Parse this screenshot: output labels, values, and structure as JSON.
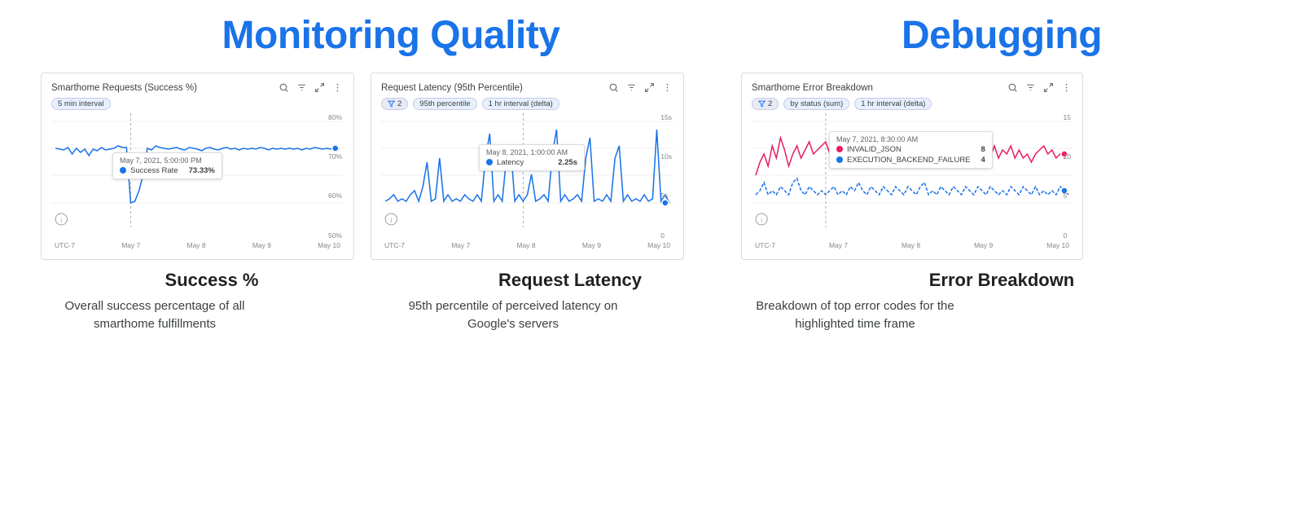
{
  "monitoring": {
    "title": "Monitoring Quality",
    "charts": [
      {
        "id": "success-rate",
        "title": "Smarthome Requests (Success %)",
        "chip": "5 min interval",
        "chip_filter": null,
        "tooltip_date": "May 7, 2021, 5:00:00 PM",
        "tooltip_label": "Success Rate",
        "tooltip_value": "73.33%",
        "tooltip_color": "#1a73e8",
        "y_labels": [
          "80%",
          "70%",
          "60%",
          "50%"
        ],
        "x_labels": [
          "UTC-7",
          "May 7",
          "May 8",
          "May 9",
          "May 10"
        ]
      },
      {
        "id": "request-latency",
        "title": "Request Latency (95th Percentile)",
        "chip": "95th percentile",
        "chip2": "1 hr interval (delta)",
        "chip_filter": "2",
        "tooltip_date": "May 8, 2021, 1:00:00 AM",
        "tooltip_label": "Latency",
        "tooltip_value": "2.25s",
        "tooltip_color": "#1a73e8",
        "y_labels": [
          "15s",
          "10s",
          "5s",
          "0"
        ],
        "x_labels": [
          "UTC-7",
          "May 7",
          "May 8",
          "May 9",
          "May 10"
        ]
      }
    ],
    "labels": [
      {
        "title": "Success %",
        "desc": "Overall success percentage of all smarthome fulfillments"
      },
      {
        "title": "Request Latency",
        "desc": "95th percentile of perceived latency on Google's servers"
      }
    ]
  },
  "debugging": {
    "title": "Debugging",
    "chart": {
      "id": "error-breakdown",
      "title": "Smarthome Error Breakdown",
      "chip_filter": "2",
      "chip2": "by status (sum)",
      "chip3": "1 hr interval (delta)",
      "tooltip_date": "May 7, 2021, 8:30:00 AM",
      "tooltip_rows": [
        {
          "label": "INVALID_JSON",
          "value": "8",
          "color": "#e91e63"
        },
        {
          "label": "EXECUTION_BACKEND_FAILURE",
          "value": "4",
          "color": "#1a73e8"
        }
      ],
      "y_labels": [
        "15",
        "10",
        "5",
        "0"
      ],
      "x_labels": [
        "UTC-7",
        "May 7",
        "May 8",
        "May 9",
        "May 10"
      ]
    },
    "label": {
      "title": "Error Breakdown",
      "desc": "Breakdown of top error codes for the highlighted time frame"
    }
  },
  "icons": {
    "search": "🔍",
    "filter": "≋",
    "fullscreen": "⛶",
    "more": "⋮"
  }
}
